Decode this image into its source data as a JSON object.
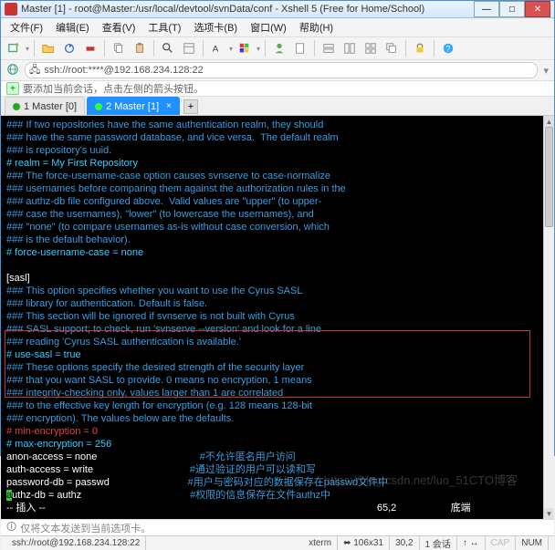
{
  "window": {
    "title": "Master [1] - root@Master:/usr/local/devtool/svnData/conf - Xshell 5 (Free for Home/School)"
  },
  "winbtn": {
    "min": "—",
    "max": "□",
    "close": "✕"
  },
  "menu": {
    "file": "文件(F)",
    "edit": "编辑(E)",
    "view": "查看(V)",
    "tools": "工具(T)",
    "options": "选项卡(B)",
    "window": "窗口(W)",
    "help": "帮助(H)"
  },
  "addr": {
    "value": "ssh://root:****@192.168.234.128:22"
  },
  "hint": {
    "plus": "+",
    "text": "要添加当前会话，点击左侧的箭头按钮。"
  },
  "tabs": {
    "t1": "1 Master [0]",
    "t2": "2 Master [1]",
    "add": "+"
  },
  "terminal": {
    "l1": "### If two repositories have the same authentication realm, they should",
    "l2": "### have the same password database, and vice versa.  The default realm",
    "l3": "### is repository's uuid.",
    "l4": "# realm = My First Repository",
    "l5": "### The force-username-case option causes svnserve to case-normalize",
    "l6": "### usernames before comparing them against the authorization rules in the",
    "l7": "### authz-db file configured above.  Valid values are \"upper\" (to upper-",
    "l8": "### case the usernames), \"lower\" (to lowercase the usernames), and",
    "l9": "### \"none\" (to compare usernames as-is without case conversion, which",
    "l10": "### is the default behavior).",
    "l11": "# force-username-case = none",
    "l12": "",
    "l13": "[sasl]",
    "l14": "### This option specifies whether you want to use the Cyrus SASL",
    "l15": "### library for authentication. Default is false.",
    "l16": "### This section will be ignored if svnserve is not built with Cyrus",
    "l17": "### SASL support; to check, run 'svnserve --version' and look for a line",
    "l18": "### reading 'Cyrus SASL authentication is available.'",
    "l19": "# use-sasl = true",
    "l20": "### These options specify the desired strength of the security layer",
    "l21": "### that you want SASL to provide. 0 means no encryption, 1 means",
    "l22": "### integrity-checking only, values larger than 1 are correlated",
    "l23": "### to the effective key length for encryption (e.g. 128 means 128-bit",
    "l24": "### encryption). The values below are the defaults.",
    "l25": "# min-encryption = 0",
    "l26": "# max-encryption = 256",
    "l27": "anon-access = none",
    "l28": "auth-access = write",
    "l29": "password-db = passwd",
    "l30a": "a",
    "l30b": "uthz-db = authz",
    "ann1": "#不允许匿名用户访问",
    "ann2": "#通过验证的用户可以读和写",
    "ann3": "#用户与密码对应的数据保存在passwd文件中",
    "ann4": "#权限的信息保存在文件authz中",
    "l31": "-- 插入 --",
    "pos": "65,2",
    "posr": "底端"
  },
  "hint2": {
    "text": "仅将文本发送到当前选项卡。"
  },
  "status": {
    "host": "ssh://root@192.168.234.128:22",
    "term": "xterm",
    "size": "106x31",
    "enc": "30,2",
    "sess": "1 会话",
    "arrow": "↑ ↔",
    "cap": "CAP",
    "num": "NUM"
  },
  "watermark": "https://blog.csdn.net/luo_51CTO博客"
}
